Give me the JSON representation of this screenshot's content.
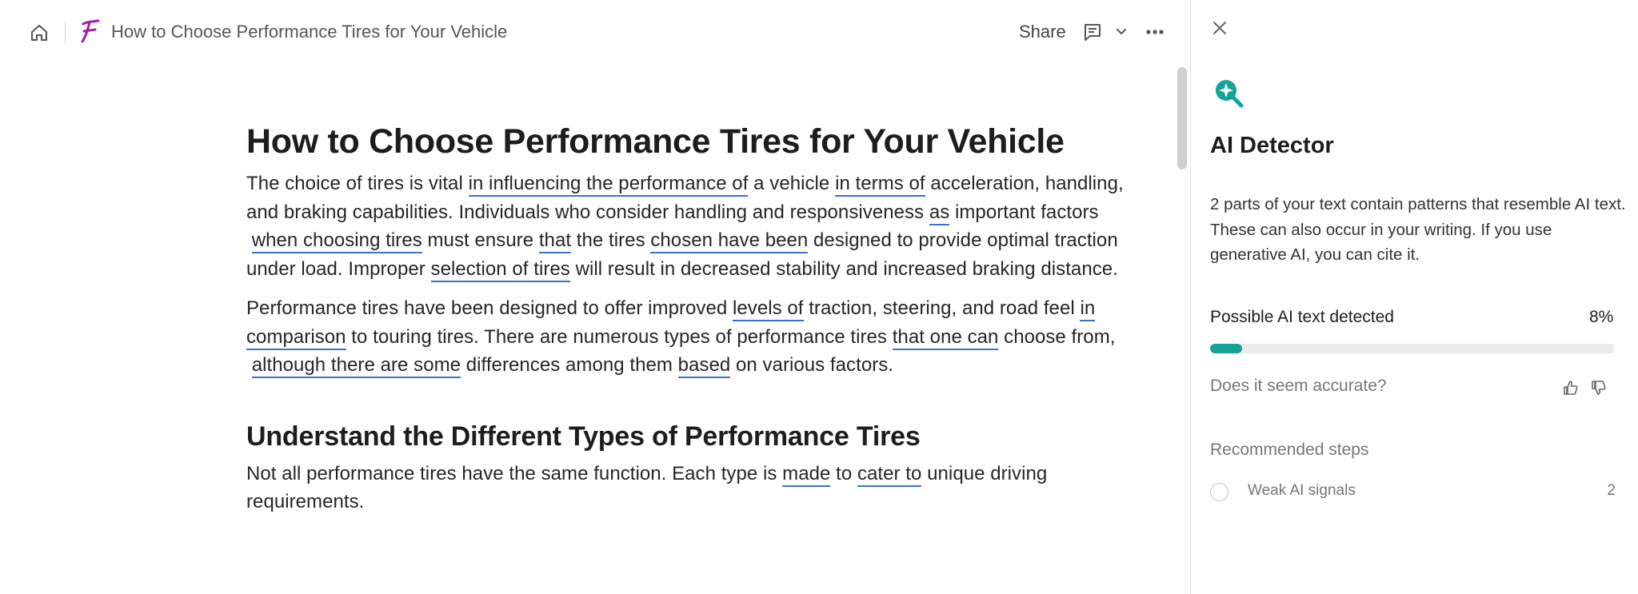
{
  "colors": {
    "accent": "#15a397",
    "logo": "#a31fa6",
    "highlight_underline": "#3b6fd4"
  },
  "topbar": {
    "doc_title": "How to Choose Performance Tires for Your Vehicle",
    "share_label": "Share",
    "icons": [
      "home-icon",
      "logo-icon",
      "comment-icon",
      "chevron-down-icon",
      "more-horizontal-icon"
    ]
  },
  "document": {
    "title": "How to Choose Performance Tires for Your Vehicle",
    "p1": [
      "The choice of tires is vital",
      "in influencing the performance of",
      "a vehicle",
      "in terms of",
      "acceleration, handling, and braking capabilities. Individuals who consider handling and responsiveness",
      "as",
      "important factors",
      "when choosing tires",
      "must ensure",
      "that",
      "the tires",
      "chosen have been",
      "designed to provide optimal traction under load. Improper",
      "selection of tires",
      "will result in decreased stability and increased braking distance."
    ],
    "p2": [
      "Performance tires have been designed to offer improved",
      "levels of",
      "traction, steering, and road feel",
      "in comparison",
      "to touring tires. There are numerous types of performance tires",
      "that one can",
      "choose from,",
      "although there are some",
      "differences among them",
      "based",
      "on various factors."
    ],
    "heading2": "Understand the Different Types of Performance Tires",
    "p3": [
      "Not all performance tires have the same function. Each type is",
      "made",
      "to",
      "cater to",
      "unique driving requirements."
    ]
  },
  "panel": {
    "icon": "ai-detector-icon",
    "title": "AI Detector",
    "description": "2 parts of your text contain patterns that resemble AI text. These can also occur in your writing. If you use generative AI, you can cite it.",
    "detected_label": "Possible AI text detected",
    "detected_percent_text": "8%",
    "detected_fraction": 0.08,
    "accuracy_question": "Does it seem accurate?",
    "recommended_heading": "Recommended steps",
    "steps": [
      {
        "label": "Weak AI signals",
        "count": "2"
      }
    ]
  }
}
